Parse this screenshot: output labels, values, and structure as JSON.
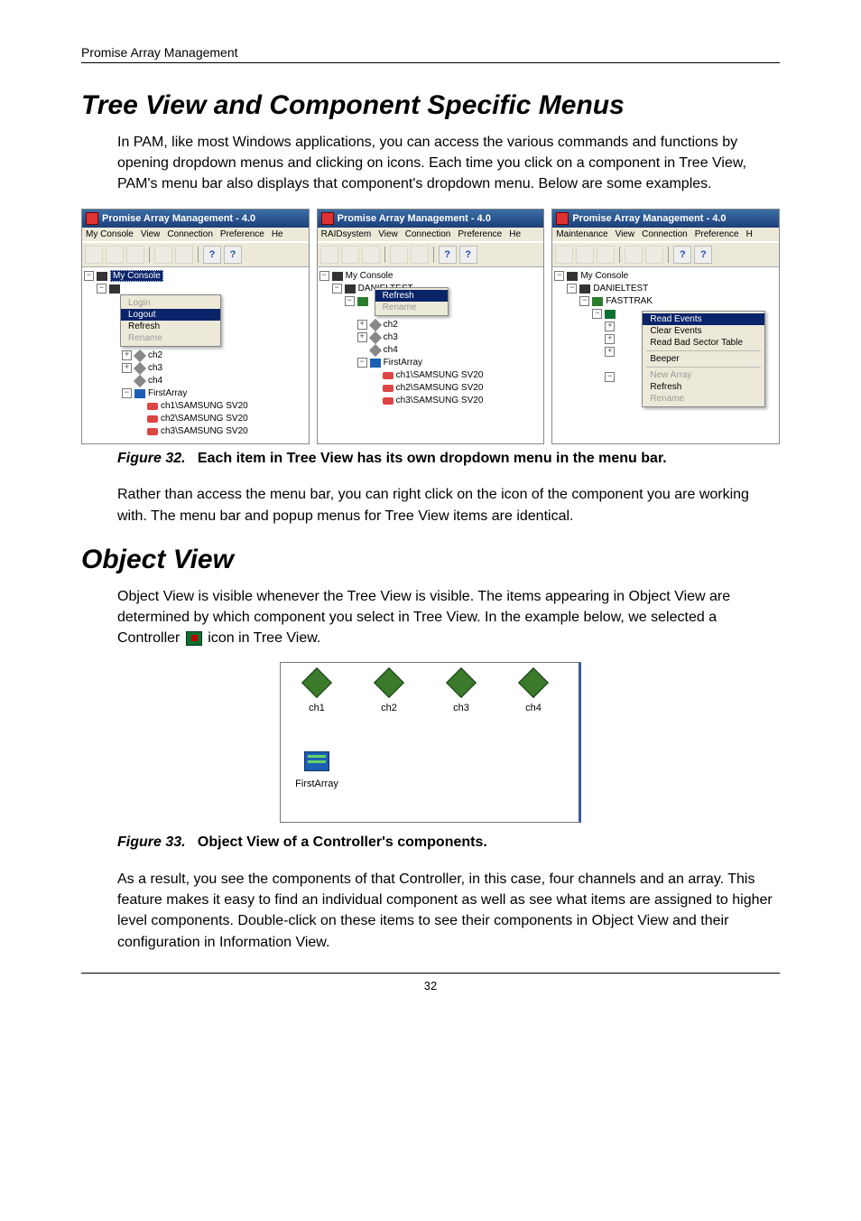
{
  "header": {
    "left": "Promise Array Management",
    "right": ""
  },
  "page_number": "32",
  "h1_tree": "Tree View and Component Specific Menus",
  "p_tree": "In PAM, like most Windows applications, you can access the various commands and functions by opening dropdown menus and clicking on icons. Each time you click on a component in Tree View, PAM's menu bar also displays that component's dropdown menu. Below are some examples.",
  "fig32_label": "Figure 32.",
  "fig32_text": "Each item in Tree View has its own dropdown menu in the menu bar.",
  "p_afterfig32": "Rather than access the menu bar, you can right click on the icon of the component you are working with. The menu bar and popup menus for Tree View items are identical.",
  "h1_obj": "Object View",
  "p_obj_1a": "Object View is visible whenever the Tree View is visible. The items appearing in Object View are determined by which component you select in Tree View. In the example below, we selected a Controller ",
  "p_obj_1b": " icon in Tree View.",
  "fig33_label": "Figure 33.",
  "fig33_text": "Object View of a Controller's components.",
  "p_obj_2": "As a result, you see the components of that Controller, in this case, four channels and an array. This feature makes it easy to find an individual component as well as see what items are assigned to higher level components. Double-click on these items to see their components in Object View and their configuration in Information View.",
  "app_title": "Promise Array Management - 4.0",
  "menubars": {
    "a": [
      "My Console",
      "View",
      "Connection",
      "Preference",
      "He"
    ],
    "b": [
      "RAIDsystem",
      "View",
      "Connection",
      "Preference",
      "He"
    ],
    "c": [
      "Maintenance",
      "View",
      "Connection",
      "Preference",
      "H"
    ]
  },
  "toolbar_help1": "?",
  "toolbar_help2": "?",
  "tree_labels": {
    "my_console": "My Console",
    "danieltest": "DANIELTEST",
    "fasttrak": "FASTTRAK",
    "ch1": "ch1",
    "ch2": "ch2",
    "ch3": "ch3",
    "ch4": "ch4",
    "firstarray": "FirstArray",
    "drv1": "ch1\\SAMSUNG SV20",
    "drv2": "ch2\\SAMSUNG SV20",
    "drv3": "ch3\\SAMSUNG SV20"
  },
  "popup_a": {
    "login": "Login",
    "logout": "Logout",
    "refresh": "Refresh",
    "rename": "Rename"
  },
  "popup_b": {
    "refresh": "Refresh",
    "rename": "Rename"
  },
  "popup_c": {
    "read_events": "Read Events",
    "clear_events": "Clear Events",
    "read_bad": "Read Bad Sector Table",
    "beeper": "Beeper",
    "new_array": "New Array",
    "refresh": "Refresh",
    "rename": "Rename"
  },
  "objview": {
    "ch1": "ch1",
    "ch2": "ch2",
    "ch3": "ch3",
    "ch4": "ch4",
    "firstarray": "FirstArray"
  }
}
